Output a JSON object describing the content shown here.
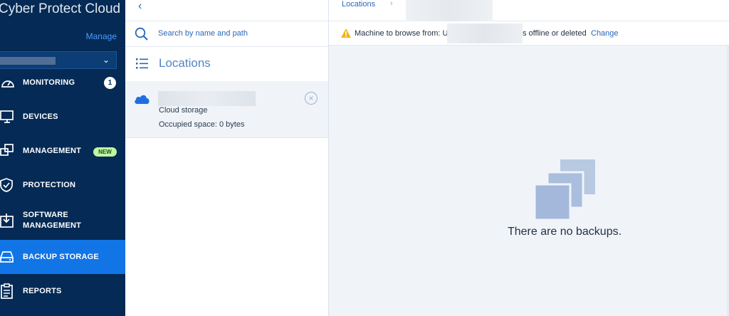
{
  "sidebar": {
    "brand": "Cyber Protect Cloud",
    "manage_label": "Manage",
    "tenant_chevron": "⌄",
    "items": [
      {
        "label": "MONITORING",
        "badge": "1"
      },
      {
        "label": "DEVICES"
      },
      {
        "label": "MANAGEMENT",
        "badge": "NEW"
      },
      {
        "label": "PROTECTION"
      },
      {
        "label": "SOFTWARE\nMANAGEMENT"
      },
      {
        "label": "BACKUP STORAGE",
        "active": true
      },
      {
        "label": "REPORTS"
      }
    ]
  },
  "panel": {
    "back_icon": "‹",
    "search_placeholder": "Search by name and path",
    "locations_title": "Locations",
    "location": {
      "type": "Cloud storage",
      "space": "Occupied space: 0 bytes",
      "remove_icon": "×"
    }
  },
  "content": {
    "breadcrumb": {
      "link": "Locations",
      "separator": "›"
    },
    "warning": {
      "text_start": "Machine to browse from: U",
      "text_end": "s offline or deleted",
      "change_label": "Change"
    },
    "empty_message": "There are no backups."
  },
  "colors": {
    "sidebar_bg": "#042a55",
    "active_item": "#1275e6",
    "link": "#2a67b8",
    "content_bg": "#f0f4f9",
    "warning": "#f3b41b",
    "empty_icon": "#b8c9e2"
  }
}
